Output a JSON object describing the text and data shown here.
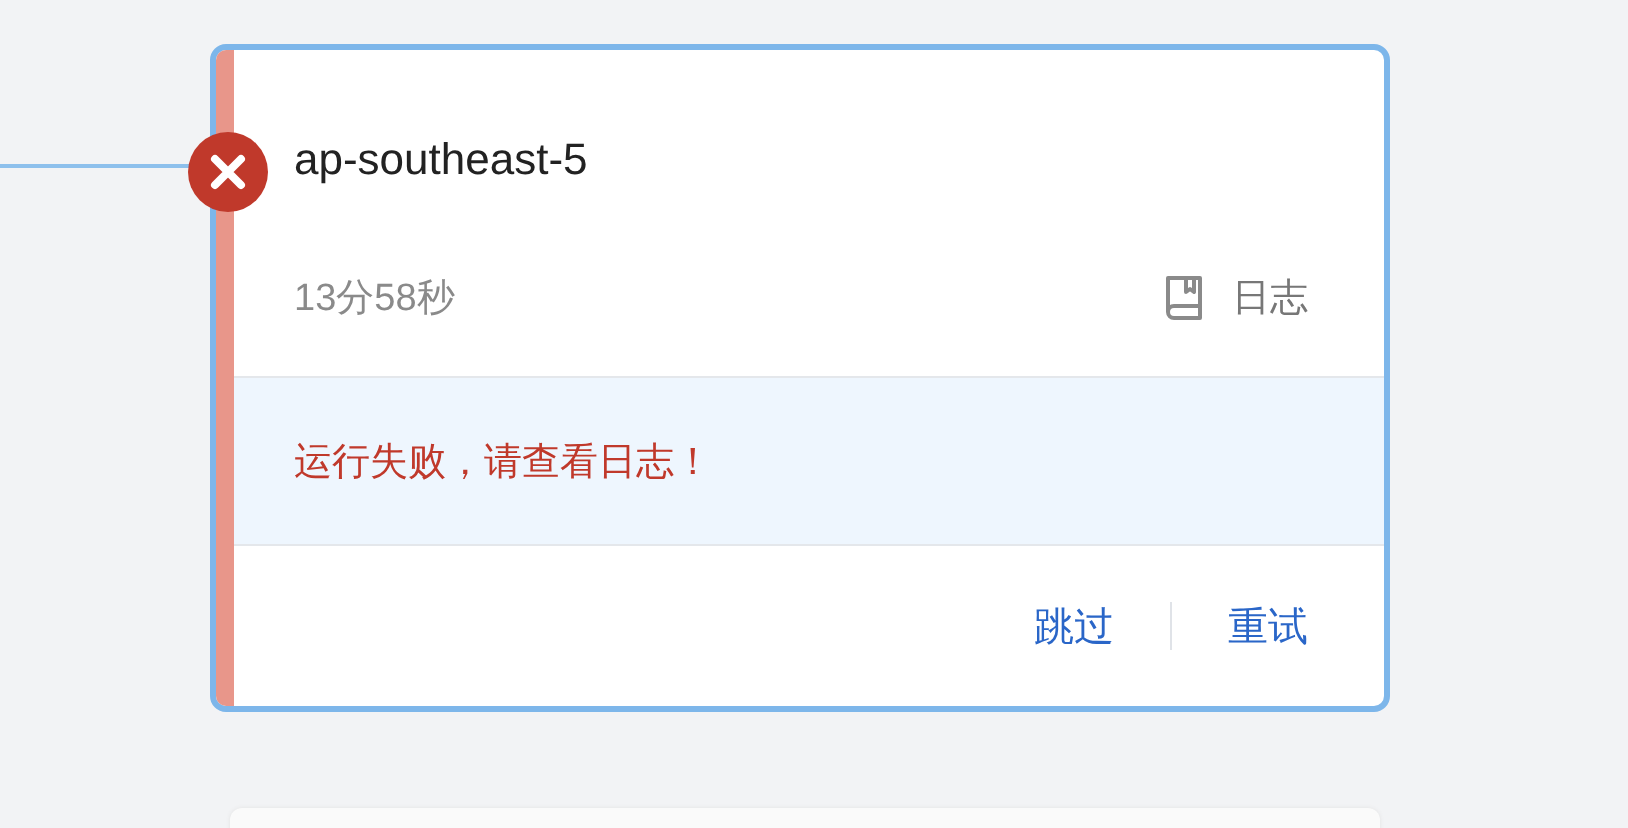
{
  "job": {
    "name": "ap-southeast-5",
    "failed": true,
    "duration": "13分58秒",
    "log_link": "日志",
    "message": "运行失败，请查看日志！",
    "actions": [
      {
        "label": "跳过"
      },
      {
        "label": "重试"
      }
    ]
  }
}
